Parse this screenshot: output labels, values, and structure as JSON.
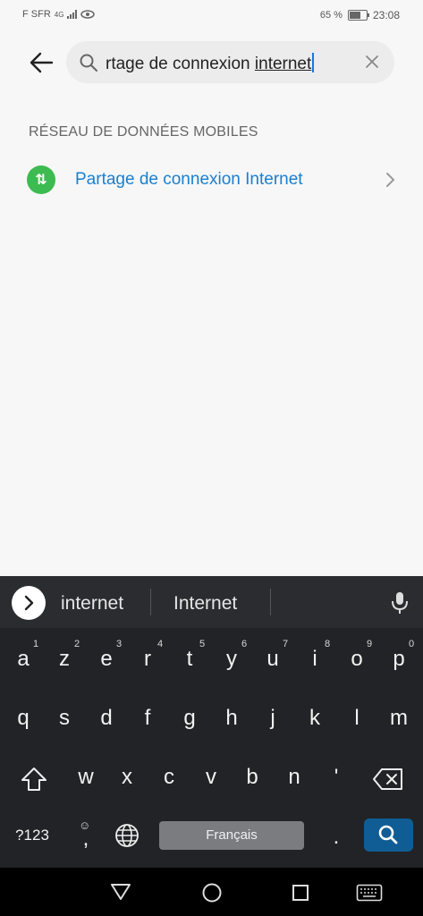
{
  "status": {
    "carrier": "F SFR",
    "network": "4G",
    "battery": "65 %",
    "time": "23:08",
    "battery_level": 0.65
  },
  "search": {
    "text_prefix": "rtage de connexion ",
    "text_underlined": "internet"
  },
  "section": {
    "title": "RÉSEAU DE DONNÉES MOBILES"
  },
  "result": {
    "label": "Partage de connexion Internet",
    "icon_glyph": "⇅"
  },
  "keyboard": {
    "suggestions": [
      "internet",
      "Internet"
    ],
    "row1": [
      {
        "k": "a",
        "h": "1"
      },
      {
        "k": "z",
        "h": "2"
      },
      {
        "k": "e",
        "h": "3"
      },
      {
        "k": "r",
        "h": "4"
      },
      {
        "k": "t",
        "h": "5"
      },
      {
        "k": "y",
        "h": "6"
      },
      {
        "k": "u",
        "h": "7"
      },
      {
        "k": "i",
        "h": "8"
      },
      {
        "k": "o",
        "h": "9"
      },
      {
        "k": "p",
        "h": "0"
      }
    ],
    "row2": [
      "q",
      "s",
      "d",
      "f",
      "g",
      "h",
      "j",
      "k",
      "l",
      "m"
    ],
    "row3": [
      "w",
      "x",
      "c",
      "v",
      "b",
      "n",
      "'"
    ],
    "sym_label": "?123",
    "comma": ",",
    "space_label": "Français",
    "period": "."
  }
}
